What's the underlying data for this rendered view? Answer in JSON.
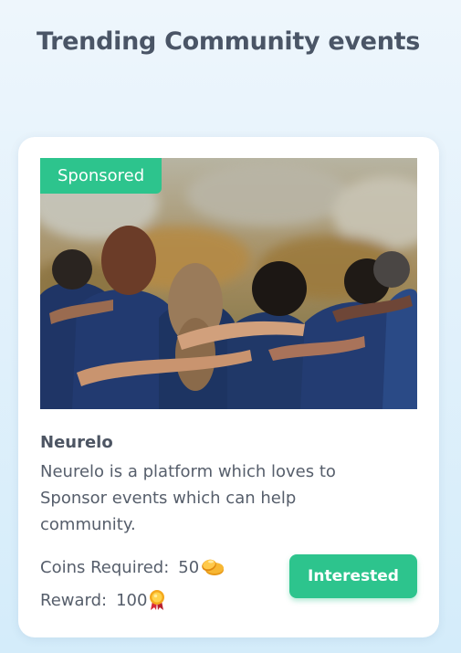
{
  "header": {
    "title": "Trending Community events"
  },
  "event_card": {
    "badge": "Sponsored",
    "image_icon": "team-huddle-photo",
    "company_name": "Neurelo",
    "description": "Neurelo is a platform which loves to Sponsor events which can help community.",
    "coins": {
      "label": "Coins Required:",
      "value": "50",
      "icon": "coins-icon"
    },
    "reward": {
      "label": "Reward:",
      "value": "100",
      "icon": "medal-icon"
    },
    "action_label": "Interested"
  },
  "colors": {
    "accent": "#2dc48d",
    "title": "#4a5566",
    "text": "#565e6b"
  }
}
